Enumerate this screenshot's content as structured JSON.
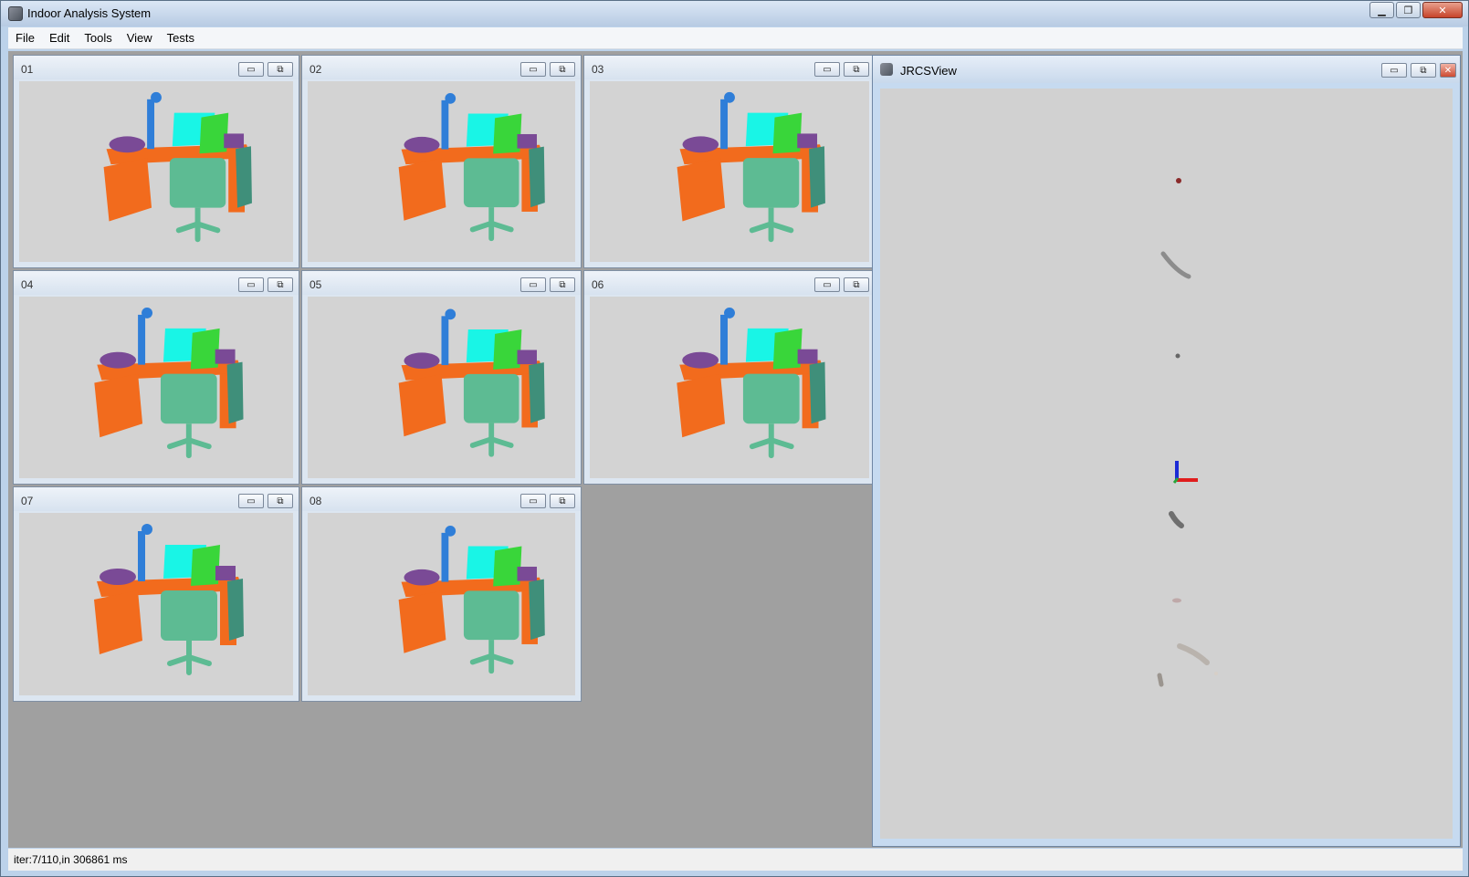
{
  "window": {
    "title": "Indoor Analysis System",
    "minimize": "▁",
    "maximize": "❐",
    "close": "✕"
  },
  "menu": [
    "File",
    "Edit",
    "Tools",
    "View",
    "Tests"
  ],
  "subwindows": [
    {
      "label": "01"
    },
    {
      "label": "02"
    },
    {
      "label": "03"
    },
    {
      "label": "04"
    },
    {
      "label": "05"
    },
    {
      "label": "06"
    },
    {
      "label": "07"
    },
    {
      "label": "08"
    }
  ],
  "sub_buttons": {
    "minimize": "▭",
    "restore": "⧉"
  },
  "jrcs": {
    "title": "JRCSView"
  },
  "status": {
    "text": "iter:7/110,in 306861 ms"
  },
  "colors": {
    "desk": "#f26b1d",
    "chair": "#5dbb93",
    "cabinet": "#3f8f7a",
    "monitor": "#19f5e6",
    "board": "#39d63a",
    "lamp": "#2f7ed8",
    "bag": "#7a4a96"
  }
}
